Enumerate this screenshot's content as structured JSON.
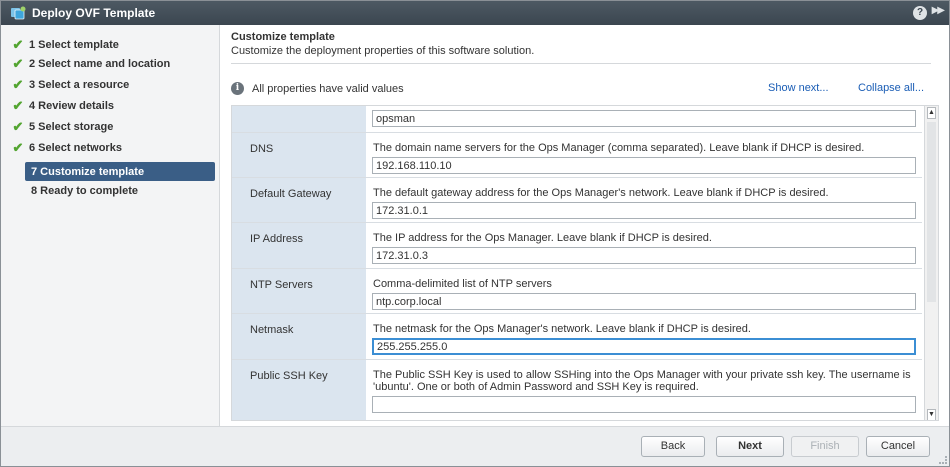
{
  "window": {
    "title": "Deploy OVF Template",
    "help_glyph": "?",
    "expand_glyph": "▶▶"
  },
  "nav": {
    "items": [
      {
        "label": "1  Select template",
        "done": true
      },
      {
        "label": "2  Select name and location",
        "done": true
      },
      {
        "label": "3  Select a resource",
        "done": true
      },
      {
        "label": "4  Review details",
        "done": true
      },
      {
        "label": "5  Select storage",
        "done": true
      },
      {
        "label": "6  Select networks",
        "done": true
      },
      {
        "label": "7  Customize template",
        "current": true
      },
      {
        "label": "8  Ready to complete"
      }
    ]
  },
  "content": {
    "heading": "Customize template",
    "subheading": "Customize the deployment properties of this software solution.",
    "validity": "All properties have valid values",
    "info_glyph": "i",
    "show_next": "Show next...",
    "collapse_all": "Collapse all..."
  },
  "properties": [
    {
      "label": "",
      "value": "opsman"
    },
    {
      "label": "DNS",
      "description": "The domain name servers for the Ops Manager (comma separated). Leave blank if DHCP is desired.",
      "value": "192.168.110.10"
    },
    {
      "label": "Default Gateway",
      "description": "The default gateway address for the Ops Manager's network. Leave blank if DHCP is desired.",
      "value": "172.31.0.1"
    },
    {
      "label": "IP Address",
      "description": "The IP address for the Ops Manager. Leave blank if DHCP is desired.",
      "value": "172.31.0.3"
    },
    {
      "label": "NTP Servers",
      "description": "Comma-delimited list of NTP servers",
      "value": "ntp.corp.local"
    },
    {
      "label": "Netmask",
      "description": "The netmask for the Ops Manager's network. Leave blank if DHCP is desired.",
      "value": "255.255.255.0"
    },
    {
      "label": "Public SSH Key",
      "description": "The Public SSH Key is used to allow SSHing into the Ops Manager with your private ssh key. The username is 'ubuntu'. One or both of Admin Password and SSH Key is required.",
      "value": ""
    }
  ],
  "scrollbar": {
    "up": "▲",
    "down": "▼"
  },
  "footer": {
    "back": "Back",
    "next": "Next",
    "finish": "Finish",
    "cancel": "Cancel"
  },
  "colors": {
    "titlebar": "#3b4650",
    "current_step": "#3a5e86",
    "label_column": "#dbe5ef",
    "link": "#1a5db5",
    "check": "#53a531",
    "focus": "#3b8ed4"
  }
}
